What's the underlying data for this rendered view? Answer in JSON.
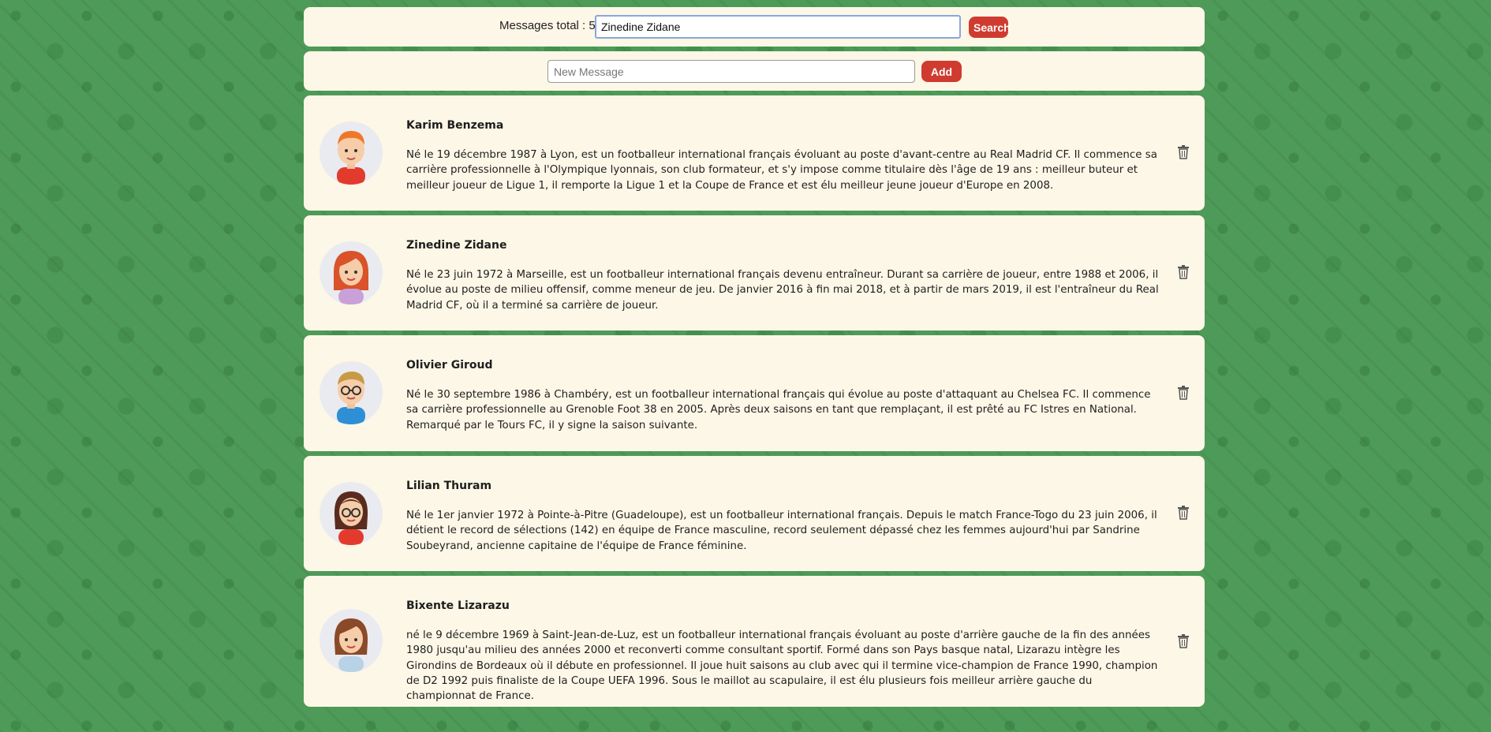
{
  "search": {
    "total_label": "Messages total : 5",
    "query": "Zinedine Zidane",
    "button_label": "Search"
  },
  "composer": {
    "placeholder": "New Message",
    "button_label": "Add"
  },
  "messages": [
    {
      "author": "Karim Benzema",
      "text": "Né le 19 décembre 1987 à Lyon, est un footballeur international français évoluant au poste d'avant-centre au Real Madrid CF. Il commence sa carrière professionnelle à l'Olympique lyonnais, son club formateur, et s'y impose comme titulaire dès l'âge de 19 ans : meilleur buteur et meilleur joueur de Ligue 1, il remporte la Ligue 1 et la Coupe de France et est élu meilleur jeune joueur d'Europe en 2008.",
      "avatar": "avatar-red-hair-man"
    },
    {
      "author": "Zinedine Zidane",
      "text": "Né le 23 juin 1972 à Marseille, est un footballeur international français devenu entraîneur. Durant sa carrière de joueur, entre 1988 et 2006, il évolue au poste de milieu offensif, comme meneur de jeu. De janvier 2016 à fin mai 2018, et à partir de mars 2019, il est l'entraîneur du Real Madrid CF, où il a terminé sa carrière de joueur.",
      "avatar": "avatar-red-hair-woman"
    },
    {
      "author": "Olivier Giroud",
      "text": "Né le 30 septembre 1986 à Chambéry, est un footballeur international français qui évolue au poste d'attaquant au Chelsea FC. Il commence sa carrière professionnelle au Grenoble Foot 38 en 2005. Après deux saisons en tant que remplaçant, il est prêté au FC Istres en National. Remarqué par le Tours FC, il y signe la saison suivante.",
      "avatar": "avatar-glasses-man"
    },
    {
      "author": "Lilian Thuram",
      "text": "Né le 1er janvier 1972 à Pointe-à-Pitre (Guadeloupe), est un footballeur international français. Depuis le match France-Togo du 23 juin 2006, il détient le record de sélections (142) en équipe de France masculine, record seulement dépassé chez les femmes aujourd'hui par Sandrine Soubeyrand, ancienne capitaine de l'équipe de France féminine.",
      "avatar": "avatar-glasses-woman"
    },
    {
      "author": "Bixente Lizarazu",
      "text": "né le 9 décembre 1969 à Saint-Jean-de-Luz, est un footballeur international français évoluant au poste d'arrière gauche de la fin des années 1980 jusqu'au milieu des années 2000 et reconverti comme consultant sportif. Formé dans son Pays basque natal, Lizarazu intègre les Girondins de Bordeaux où il débute en professionnel. Il joue huit saisons au club avec qui il termine vice-champion de France 1990, champion de D2 1992 puis finaliste de la Coupe UEFA 1996. Sous le maillot au scapulaire, il est élu plusieurs fois meilleur arrière gauche du championnat de France.",
      "avatar": "avatar-brown-hair-woman"
    }
  ],
  "colors": {
    "background": "#4e9a58",
    "panel": "#fcf7e6",
    "button": "#d03b30"
  },
  "icons": {
    "delete": "trash-icon"
  }
}
